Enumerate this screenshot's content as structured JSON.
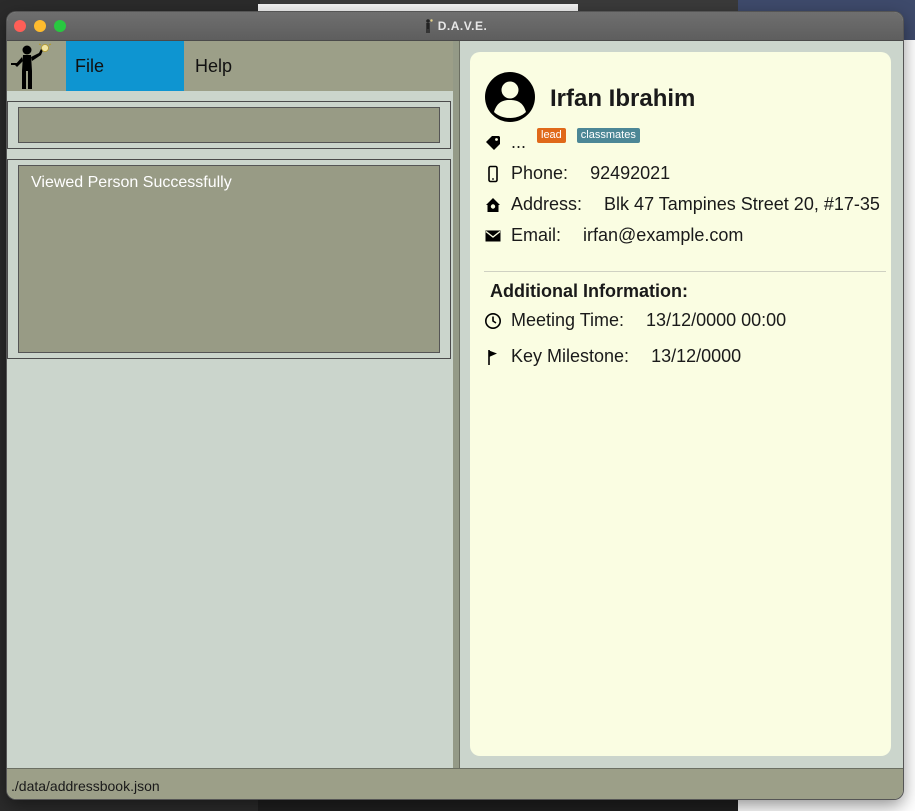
{
  "window": {
    "title": "D.A.V.E."
  },
  "menu": {
    "file": "File",
    "help": "Help"
  },
  "command": {
    "value": "",
    "placeholder": ""
  },
  "result": {
    "message": "Viewed Person Successfully"
  },
  "person": {
    "name": "Irfan Ibrahim",
    "tags_placeholder": "...",
    "tags": [
      {
        "label": "lead",
        "color": "#e0691a"
      },
      {
        "label": "classmates",
        "color": "#4c8796"
      }
    ],
    "phone_label": "Phone:",
    "phone": "92492021",
    "address_label": "Address:",
    "address": "Blk 47 Tampines Street 20, #17-35",
    "email_label": "Email:",
    "email": "irfan@example.com",
    "additional_heading": "Additional Information:",
    "meeting_label": "Meeting Time:",
    "meeting": "13/12/0000 00:00",
    "milestone_label": "Key Milestone:",
    "milestone": "13/12/0000"
  },
  "status": {
    "path": "./data/addressbook.json"
  },
  "colors": {
    "menu_accent": "#0e95d1",
    "card_bg": "#fafde2",
    "tag_lead": "#e0691a",
    "tag_classmates": "#4c8796"
  }
}
